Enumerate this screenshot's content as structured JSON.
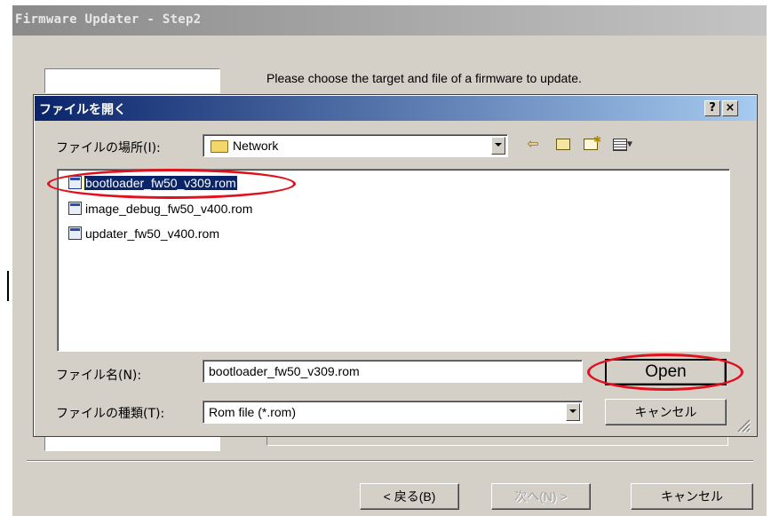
{
  "wizard": {
    "title": "Firmware Updater - Step2",
    "description": "Please choose the target and file of a firmware to update.",
    "back_button": "< 戻る(B)",
    "next_button": "次へ(N) >",
    "cancel_button": "キャンセル"
  },
  "dialog": {
    "title": "ファイルを開く",
    "help_button": "?",
    "close_button": "×",
    "look_in_label": "ファイルの場所(I):",
    "look_in_value": "Network",
    "files": [
      {
        "name": "bootloader_fw50_v309.rom",
        "selected": true
      },
      {
        "name": "image_debug_fw50_v400.rom",
        "selected": false
      },
      {
        "name": "updater_fw50_v400.rom",
        "selected": false
      }
    ],
    "filename_label": "ファイル名(N):",
    "filename_value": "bootloader_fw50_v309.rom",
    "filetype_label": "ファイルの種類(T):",
    "filetype_value": "Rom file (*.rom)",
    "open_button": "Open",
    "cancel_button": "キャンセル"
  },
  "colors": {
    "highlight_ring": "#e0101c",
    "dialog_titlebar": "#0a246a",
    "selection": "#0a246a",
    "face": "#d4d0c8"
  },
  "icons": [
    "folder-icon",
    "back-arrow-icon",
    "up-folder-icon",
    "new-folder-icon",
    "view-menu-icon",
    "rom-file-icon",
    "resize-grip-icon"
  ]
}
